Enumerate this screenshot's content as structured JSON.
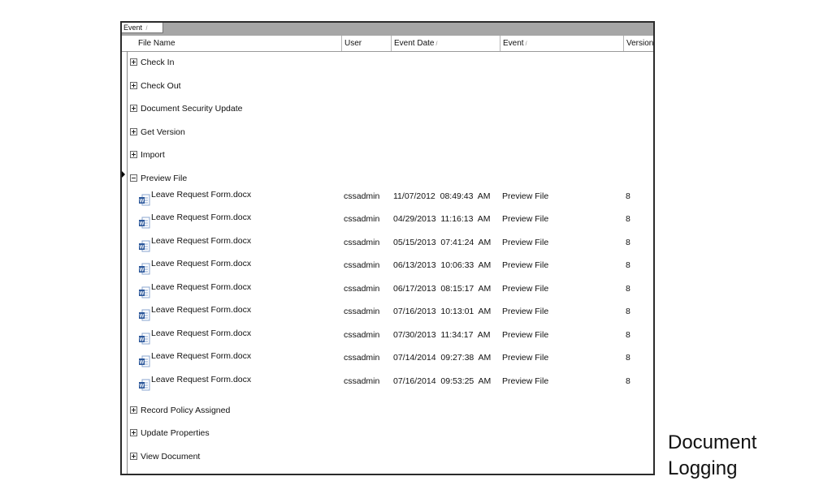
{
  "group_panel": {
    "chip_label": "Event",
    "chip_sort": "/"
  },
  "columns": [
    {
      "label": "File Name",
      "sort": ""
    },
    {
      "label": "User",
      "sort": ""
    },
    {
      "label": "Event Date",
      "sort": "/"
    },
    {
      "label": "Event",
      "sort": "/"
    },
    {
      "label": "Version",
      "sort": ""
    }
  ],
  "groups_before": [
    "Check In",
    "Check Out",
    "Document Security Update",
    "Get Version",
    "Import"
  ],
  "expanded_group": {
    "label": "Preview File",
    "rows": [
      {
        "file": "Leave Request Form.docx",
        "user": "cssadmin",
        "date": "11/07/2012  08:49:43  AM",
        "event": "Preview File",
        "version": "8"
      },
      {
        "file": "Leave Request Form.docx",
        "user": "cssadmin",
        "date": "04/29/2013  11:16:13  AM",
        "event": "Preview File",
        "version": "8"
      },
      {
        "file": "Leave Request Form.docx",
        "user": "cssadmin",
        "date": "05/15/2013  07:41:24  AM",
        "event": "Preview File",
        "version": "8"
      },
      {
        "file": "Leave Request Form.docx",
        "user": "cssadmin",
        "date": "06/13/2013  10:06:33  AM",
        "event": "Preview File",
        "version": "8"
      },
      {
        "file": "Leave Request Form.docx",
        "user": "cssadmin",
        "date": "06/17/2013  08:15:17  AM",
        "event": "Preview File",
        "version": "8"
      },
      {
        "file": "Leave Request Form.docx",
        "user": "cssadmin",
        "date": "07/16/2013  10:13:01  AM",
        "event": "Preview File",
        "version": "8"
      },
      {
        "file": "Leave Request Form.docx",
        "user": "cssadmin",
        "date": "07/30/2013  11:34:17  AM",
        "event": "Preview File",
        "version": "8"
      },
      {
        "file": "Leave Request Form.docx",
        "user": "cssadmin",
        "date": "07/14/2014  09:27:38  AM",
        "event": "Preview File",
        "version": "8"
      },
      {
        "file": "Leave Request Form.docx",
        "user": "cssadmin",
        "date": "07/16/2014  09:53:25  AM",
        "event": "Preview File",
        "version": "8"
      }
    ]
  },
  "groups_after": [
    "Record Policy Assigned",
    "Update Properties",
    "View Document"
  ],
  "caption": {
    "line1": "Document",
    "line2": "Logging"
  },
  "icons": {
    "file_icon": "word-document-icon",
    "word_blue": "#2b579a"
  },
  "colors": {
    "group_panel_bg": "#a6a6a6",
    "frame_border": "#2b2b2b"
  }
}
